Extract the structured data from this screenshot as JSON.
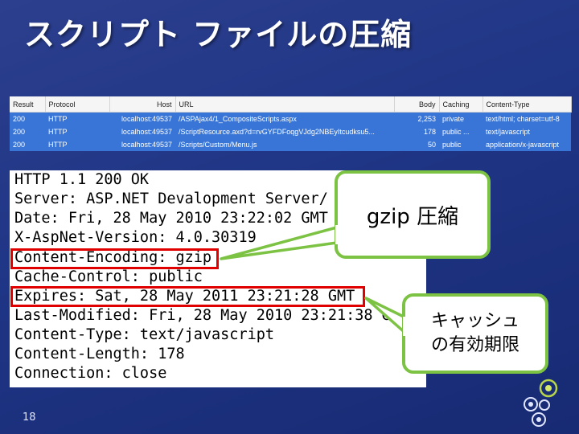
{
  "slide": {
    "title": "スクリプト ファイルの圧縮",
    "page_number": "18"
  },
  "fiddler": {
    "columns": [
      "Result",
      "Protocol",
      "Host",
      "URL",
      "Body",
      "Caching",
      "Content-Type"
    ],
    "rows": [
      [
        "200",
        "HTTP",
        "localhost:49537",
        "/ASPAjax4/1_CompositeScripts.aspx",
        "2,253",
        "private",
        "text/html; charset=utf-8"
      ],
      [
        "200",
        "HTTP",
        "localhost:49537",
        "/ScriptResource.axd?d=rvGYFDFoqgVJdg2NBEyItcudksu5...",
        "178",
        "public ...",
        "text/javascript"
      ],
      [
        "200",
        "HTTP",
        "localhost:49537",
        "/Scripts/Custom/Menu.js",
        "50",
        "public",
        "application/x-javascript"
      ]
    ]
  },
  "headers": {
    "lines": [
      "HTTP 1.1 200 OK",
      "Server: ASP.NET Devalopment Server/",
      "Date: Fri, 28 May 2010 23:22:02 GMT",
      "X-AspNet-Version: 4.0.30319",
      "Content-Encoding: gzip",
      "Cache-Control: public",
      "Expires: Sat, 28 May 2011 23:21:28 GMT",
      "Last-Modified: Fri, 28 May 2010 23:21:38 G",
      "Content-Type: text/javascript",
      "Content-Length: 178",
      "Connection: close"
    ]
  },
  "callouts": {
    "gzip": "gzip 圧縮",
    "expires_line1": "キャッシュ",
    "expires_line2": "の有効期限"
  },
  "colors": {
    "background": "#1f3585",
    "selection": "#3875d7",
    "highlight": "#e00000",
    "callout_border": "#7cc243"
  }
}
